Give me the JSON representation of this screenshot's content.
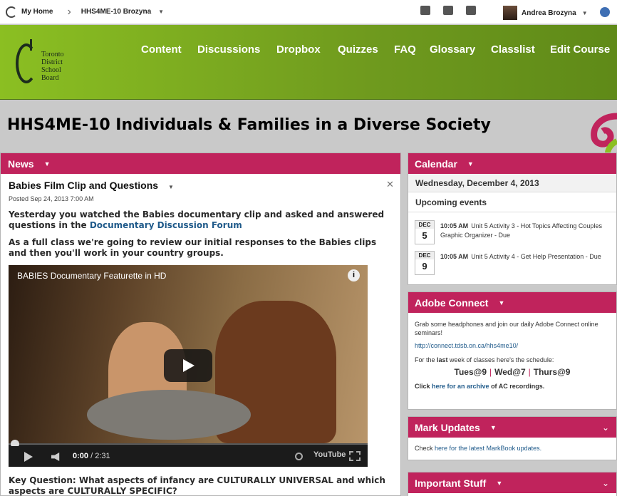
{
  "topbar": {
    "home_label": "My Home",
    "course_label": "HHS4ME-10 Brozyna",
    "user_name": "Andrea Brozyna"
  },
  "header": {
    "logo_text": [
      "Toronto",
      "District",
      "School",
      "Board"
    ],
    "nav": [
      "Content",
      "Discussions",
      "Dropbox",
      "Quizzes",
      "FAQ",
      "Glossary",
      "Classlist",
      "Edit Course"
    ]
  },
  "page_title": "HHS4ME-10 Individuals & Families in a Diverse Society",
  "news": {
    "title": "News",
    "item_title": "Babies Film Clip and Questions",
    "posted": "Posted Sep 24, 2013 7:00 AM",
    "para1_pre": "Yesterday you watched the Babies documentary clip and asked and answered questions in the ",
    "para1_link": "Documentary Discussion Forum",
    "para2": "As a full class we're going to review our initial responses to the Babies clips and then you'll work in your country groups.",
    "video": {
      "title": "BABIES Documentary Featurette in HD",
      "time_current": "0:00",
      "time_total": "/ 2:31",
      "brand": "YouTube",
      "progress": 0
    },
    "key_question": "Key Question: What aspects of infancy are CULTURALLY UNIVERSAL and which aspects are CULTURALLY SPECIFIC?"
  },
  "calendar": {
    "title": "Calendar",
    "date": "Wednesday, December 4, 2013",
    "upcoming_label": "Upcoming events",
    "events": [
      {
        "month": "DEC",
        "day": "5",
        "time": "10:05 AM",
        "text": "Unit 5 Activity 3 - Hot Topics Affecting Couples Graphic Organizer - Due"
      },
      {
        "month": "DEC",
        "day": "9",
        "time": "10:05 AM",
        "text": "Unit 5 Activity 4 - Get Help Presentation - Due"
      }
    ]
  },
  "adobe": {
    "title": "Adobe Connect",
    "intro": "Grab some headphones and join our daily Adobe Connect online seminars!",
    "link": "http://connect.tdsb.on.ca/hhs4me10/",
    "last_week_pre": "For the ",
    "last_week_bold": "last",
    "last_week_post": " week of classes here's the schedule:",
    "schedule": [
      "Tues@9",
      "Wed@7",
      "Thurs@9"
    ],
    "archive_pre": "Click ",
    "archive_link": "here for an archive",
    "archive_post": " of AC recordings."
  },
  "mark": {
    "title": "Mark Updates",
    "pre": "Check ",
    "link": "here for the latest MarkBook updates."
  },
  "important": {
    "title": "Important Stuff"
  }
}
